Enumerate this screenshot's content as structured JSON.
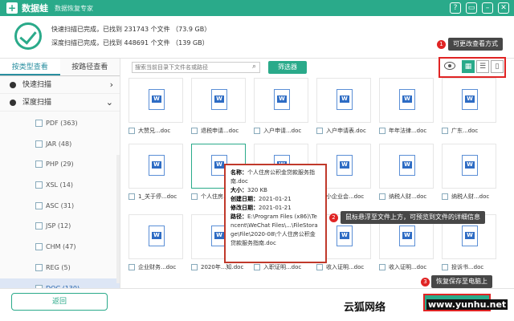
{
  "app": {
    "logo_glyph": "+",
    "name": "数据蛙",
    "slogan": "数据恢复专家"
  },
  "window_buttons": [
    "?",
    "▭",
    "–",
    "✕"
  ],
  "status": {
    "quick": "快速扫描已完成，已找到 231743 个文件 （73.9 GB）",
    "deep": "深度扫描已完成，已找到 448691 个文件 （139 GB）"
  },
  "sidebar": {
    "tabs": [
      "按类型查看",
      "按路径查看"
    ],
    "quick_scan": "快速扫描",
    "deep_scan": "深度扫描",
    "items": [
      {
        "label": "PDF (363)"
      },
      {
        "label": "JAR (48)"
      },
      {
        "label": "PHP (29)"
      },
      {
        "label": "XSL (14)"
      },
      {
        "label": "ASC (31)"
      },
      {
        "label": "JSP (12)"
      },
      {
        "label": "CHM (47)"
      },
      {
        "label": "REG (5)"
      },
      {
        "label": "DOC (130)"
      }
    ]
  },
  "toolbar": {
    "search_placeholder": "搜索当前目录下文件名或路径",
    "filter_label": "筛选器"
  },
  "view_buttons": [
    "▦",
    "☰",
    "▯"
  ],
  "files": [
    {
      "name": "大赞兄...doc"
    },
    {
      "name": "退税申请...doc"
    },
    {
      "name": "入户申请...doc"
    },
    {
      "name": "入户申请表.doc"
    },
    {
      "name": "年年法律...doc"
    },
    {
      "name": "广东...doc"
    },
    {
      "name": "1_关于停...doc"
    },
    {
      "name": "个人住房...doc"
    },
    {
      "name": ""
    },
    {
      "name": "小企业会...doc"
    },
    {
      "name": "纳税人财...doc"
    },
    {
      "name": "纳税人财...doc"
    },
    {
      "name": "企业财务...doc"
    },
    {
      "name": "2020年...知.doc"
    },
    {
      "name": "入职证明...doc"
    },
    {
      "name": "收入证明...doc"
    },
    {
      "name": "收入证明...doc"
    },
    {
      "name": "投诉书...doc"
    }
  ],
  "tooltip": {
    "name_label": "名称：",
    "name_value": "个人住房公积金贷款服务指南.doc",
    "size_label": "大小：",
    "size_value": "320 KB",
    "created_label": "创建日期：",
    "created_value": "2021-01-21",
    "modified_label": "修改日期：",
    "modified_value": "2021-01-21",
    "path_label": "路径：",
    "path_value": "E:\\Program Files (x86)\\Tencent\\WeChat Files\\...\\FileStorage\\File\\2020-08\\个人住房公积金贷款服务指南.doc"
  },
  "annotations": [
    {
      "num": "1",
      "text": "可更改查看方式"
    },
    {
      "num": "2",
      "text": "鼠标悬浮至文件上方，可预览到文件的详细信息"
    },
    {
      "num": "3",
      "text": "恢复保存至电脑上"
    }
  ],
  "bottom": {
    "back_label": "返回"
  },
  "watermark": {
    "text": "云狐网络",
    "url": "www.yunhu.net"
  },
  "colors": {
    "brand": "#2aaa8a",
    "highlight": "#e02424",
    "selected_bg": "#dde6f5"
  }
}
